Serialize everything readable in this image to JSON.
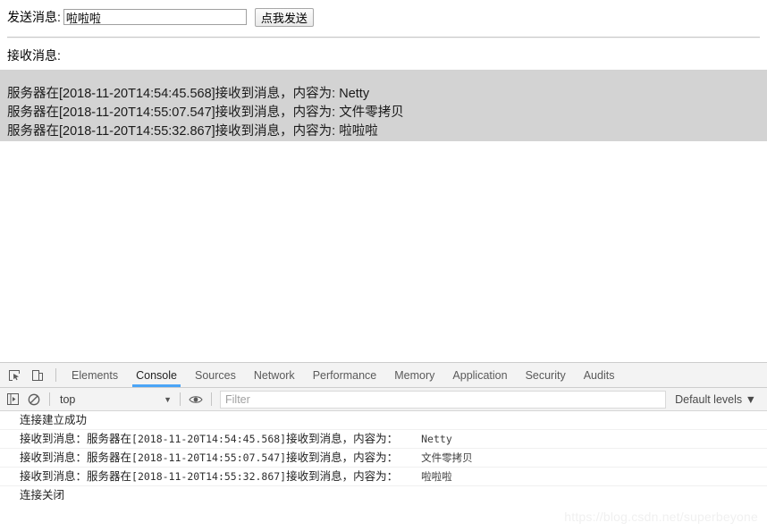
{
  "page": {
    "send_label": "发送消息:",
    "send_input_value": "啦啦啦",
    "send_input_placeholder": "",
    "send_button_label": "点我发送",
    "receive_label": "接收消息:",
    "messages": [
      "服务器在[2018-11-20T14:54:45.568]接收到消息，内容为: Netty",
      "服务器在[2018-11-20T14:55:07.547]接收到消息，内容为: 文件零拷贝",
      "服务器在[2018-11-20T14:55:32.867]接收到消息，内容为: 啦啦啦"
    ]
  },
  "devtools": {
    "inspect_icon": "inspect-element-icon",
    "device_icon": "device-toolbar-icon",
    "tabs": [
      {
        "label": "Elements",
        "active": false
      },
      {
        "label": "Console",
        "active": true
      },
      {
        "label": "Sources",
        "active": false
      },
      {
        "label": "Network",
        "active": false
      },
      {
        "label": "Performance",
        "active": false
      },
      {
        "label": "Memory",
        "active": false
      },
      {
        "label": "Application",
        "active": false
      },
      {
        "label": "Security",
        "active": false
      },
      {
        "label": "Audits",
        "active": false
      }
    ],
    "filterbar": {
      "sidebar_icon": "show-console-sidebar-icon",
      "clear_icon": "clear-console-icon",
      "context": "top",
      "context_caret": "▼",
      "eye_icon": "live-expression-eye-icon",
      "filter_placeholder": "Filter",
      "filter_value": "",
      "levels_label": "Default levels",
      "levels_caret": "▼"
    },
    "console_rows": [
      {
        "text": "连接建立成功",
        "ts": "",
        "payload": "",
        "prefix": ""
      },
      {
        "prefix": "接收到消息：服务器在",
        "ts": "[2018-11-20T14:54:45.568]",
        "text": "接收到消息，内容为：",
        "payload": "Netty"
      },
      {
        "prefix": "接收到消息：服务器在",
        "ts": "[2018-11-20T14:55:07.547]",
        "text": "接收到消息，内容为：",
        "payload": "文件零拷贝"
      },
      {
        "prefix": "接收到消息：服务器在",
        "ts": "[2018-11-20T14:55:32.867]",
        "text": "接收到消息，内容为：",
        "payload": "啦啦啦"
      },
      {
        "text": "连接关闭",
        "ts": "",
        "payload": "",
        "prefix": ""
      }
    ],
    "prompt_arrow": ">",
    "accent_color": "#4ba5f7"
  },
  "watermark": "https://blog.csdn.net/superbeyone"
}
